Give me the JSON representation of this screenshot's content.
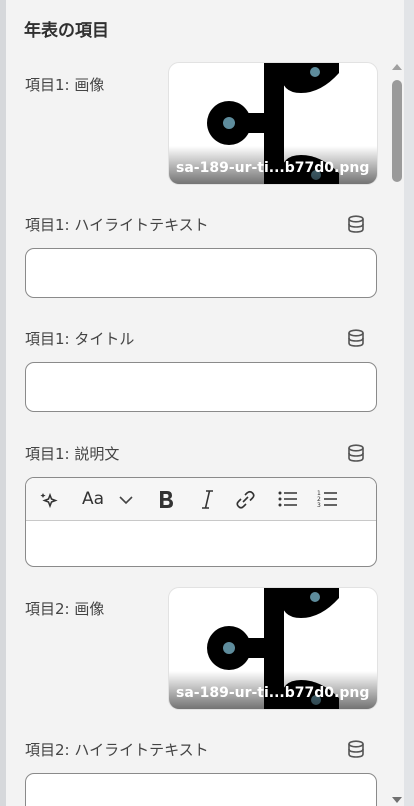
{
  "panel": {
    "title": "年表の項目"
  },
  "items": [
    {
      "image_label": "項目1: 画像",
      "image_filename": "sa-189-ur-ti...b77d0.png",
      "highlight_label": "項目1: ハイライトテキスト",
      "highlight_value": "",
      "title_label": "項目1: タイトル",
      "title_value": "",
      "desc_label": "項目1: 説明文",
      "desc_value": ""
    },
    {
      "image_label": "項目2: 画像",
      "image_filename": "sa-189-ur-ti...b77d0.png",
      "highlight_label": "項目2: ハイライトテキスト",
      "highlight_value": ""
    }
  ],
  "rte_toolbar": {
    "font_button": "Aa"
  },
  "icons": [
    "database-icon",
    "sparkle-icon",
    "font-icon",
    "chevron-down-icon",
    "bold-icon",
    "italic-icon",
    "link-icon",
    "bullet-list-icon",
    "numbered-list-icon"
  ]
}
